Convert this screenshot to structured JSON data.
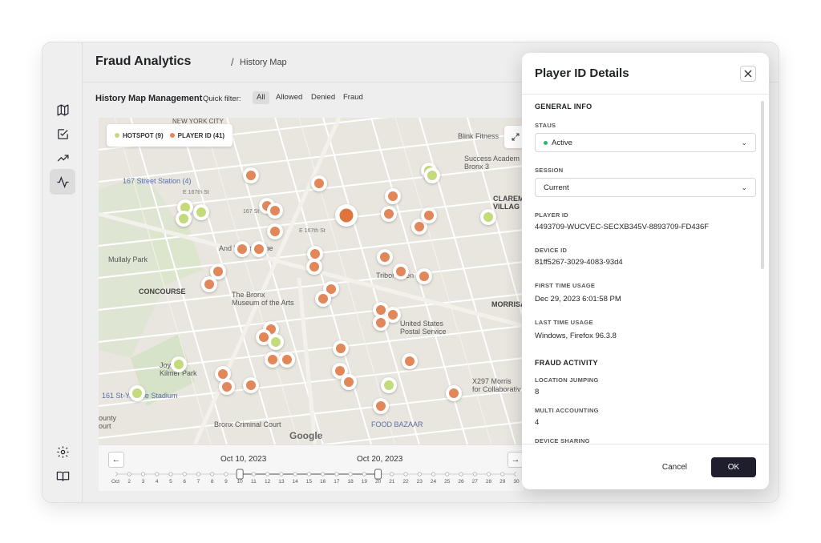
{
  "header": {
    "title": "Fraud Analytics",
    "separator": "/",
    "breadcrumb": "History Map"
  },
  "sidebar": {
    "items": [
      {
        "icon": "map-icon"
      },
      {
        "icon": "checklist-icon"
      },
      {
        "icon": "trending-up-icon"
      },
      {
        "icon": "activity-icon",
        "active": true
      }
    ],
    "bottom": [
      {
        "icon": "settings-icon"
      },
      {
        "icon": "book-icon"
      }
    ]
  },
  "toolbar": {
    "title": "History Map Management",
    "filter_label": "Quick filter:",
    "filters": [
      "All",
      "Allowed",
      "Denied",
      "Fraud"
    ],
    "selected_filter": "All"
  },
  "map": {
    "legend": [
      {
        "label": "HOTSPOT (9)",
        "color": "#c4db7c"
      },
      {
        "label": "PLAYER ID (41)",
        "color": "#e2875a"
      }
    ],
    "labels": {
      "station": "167 Street Station (4)",
      "concourse": "CONCOURSE",
      "museum": "The Bronx\nMuseum of the Arts",
      "mullaly": "Mullaly Park",
      "blink": "Blink Fitness",
      "success": "Success Academ\nBronx 3",
      "claremont": "CLAREMO\nVILLAG",
      "morrisa": "MORRISA",
      "postal": "United States\nPostal Service",
      "criminal": "Bronx Criminal Court",
      "food": "FOOD BAZAAR",
      "joyce": "Joyce\nKilmer Park",
      "x297": "X297 Morris\nfor Collaborativ",
      "yankee": "161 St-Yankee Stadium",
      "triboro": "Triboro Cen",
      "andrew": "And    hman Home",
      "county": "ounty\nourt",
      "nycity": "NEW YORK CITY",
      "e167": "E 167th St",
      "e167b": "E 167th St",
      "s167": "167 St",
      "google": "Google"
    }
  },
  "timeline": {
    "start_date": "Oct 10, 2023",
    "end_date": "Oct 20, 2023",
    "days": [
      "Oct",
      "2",
      "3",
      "4",
      "5",
      "6",
      "7",
      "8",
      "9",
      "10",
      "11",
      "12",
      "13",
      "14",
      "15",
      "16",
      "17",
      "18",
      "19",
      "20",
      "21",
      "22",
      "23",
      "24",
      "25",
      "26",
      "27",
      "28",
      "29",
      "30"
    ],
    "prev_label": "←",
    "next_label": "→"
  },
  "panel": {
    "title": "Player ID Details",
    "general_info": "GENERAL INFO",
    "status_label": "STAUS",
    "status_value": "Active",
    "status_color": "#2bb673",
    "session_label": "SESSION",
    "session_value": "Current",
    "player_id_label": "PLAYER ID",
    "player_id": "4493709-WUCVEC-SECXB345V-8893709-FD436F",
    "device_id_label": "DEVICE ID",
    "device_id": "81ff5267-3029-4083-93d4",
    "first_usage_label": "FIRST TIME USAGE",
    "first_usage": "Dec 29, 2023 6:01:58 PM",
    "last_usage_label": "LAST TIME USAGE",
    "last_usage": "Windows, Firefox 96.3.8",
    "fraud_activity": "FRAUD ACTIVITY",
    "location_jumping_label": "LOCATION JUMPING",
    "location_jumping": "8",
    "multi_accounting_label": "MULTI ACCOUNTING",
    "multi_accounting": "4",
    "device_sharing_label": "DEVICE SHARING",
    "cancel": "Cancel",
    "ok": "OK"
  }
}
